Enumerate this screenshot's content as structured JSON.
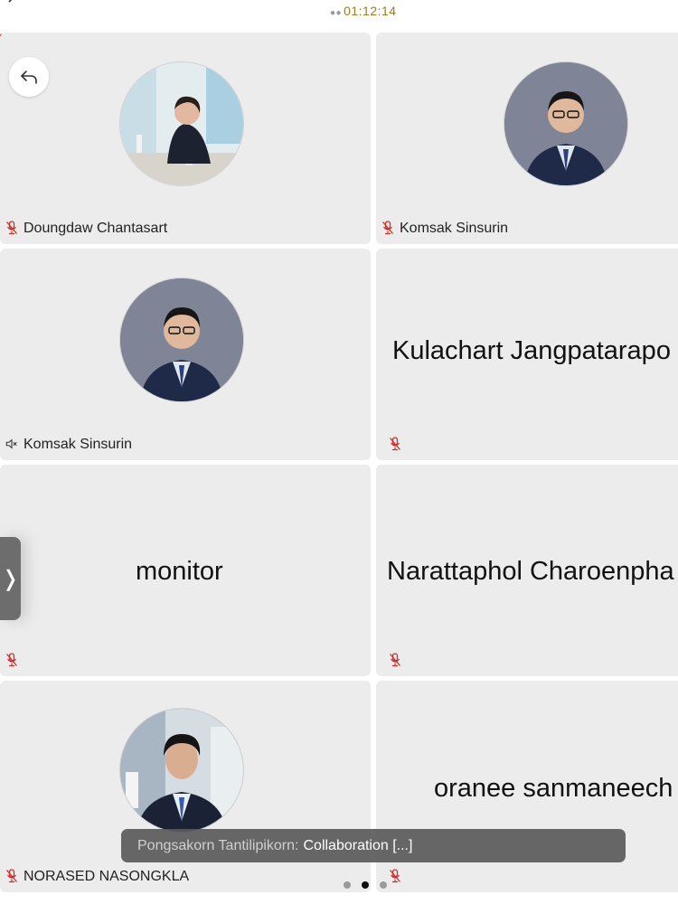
{
  "meeting": {
    "elapsed_time": "01:12:14"
  },
  "status_bar": {
    "icons": [
      "mic-muted-icon",
      "signal-icon",
      "record-icon"
    ],
    "colors": {
      "muted": "#e0322f",
      "signal": "#2ea35a",
      "record": "#e0322f"
    }
  },
  "participants": [
    {
      "name": "Doungdaw Chantasart",
      "mic": "muted",
      "display": "photo"
    },
    {
      "name": "Komsak Sinsurin",
      "mic": "muted",
      "display": "photo"
    },
    {
      "name": "Komsak Sinsurin",
      "mic": "speaker-muted",
      "display": "photo"
    },
    {
      "name": "Kulachart Jangpatarapo",
      "mic": "muted",
      "display": "name"
    },
    {
      "name": "monitor",
      "mic": "muted",
      "display": "name"
    },
    {
      "name": "Narattaphol Charoenpha",
      "mic": "muted",
      "display": "name"
    },
    {
      "name": "NORASED NASONGKLA",
      "mic": "muted",
      "display": "photo"
    },
    {
      "name": "oranee sanmaneech",
      "mic": "muted",
      "display": "name"
    }
  ],
  "chat_toast": {
    "sender": "Pongsakorn Tantilipikorn:",
    "message": "Collaboration [...]"
  },
  "pager": {
    "pages": 3,
    "current": 2
  },
  "colors": {
    "tile_bg": "#ececec",
    "muted_red": "#c8302c",
    "timer": "#a0781e"
  }
}
